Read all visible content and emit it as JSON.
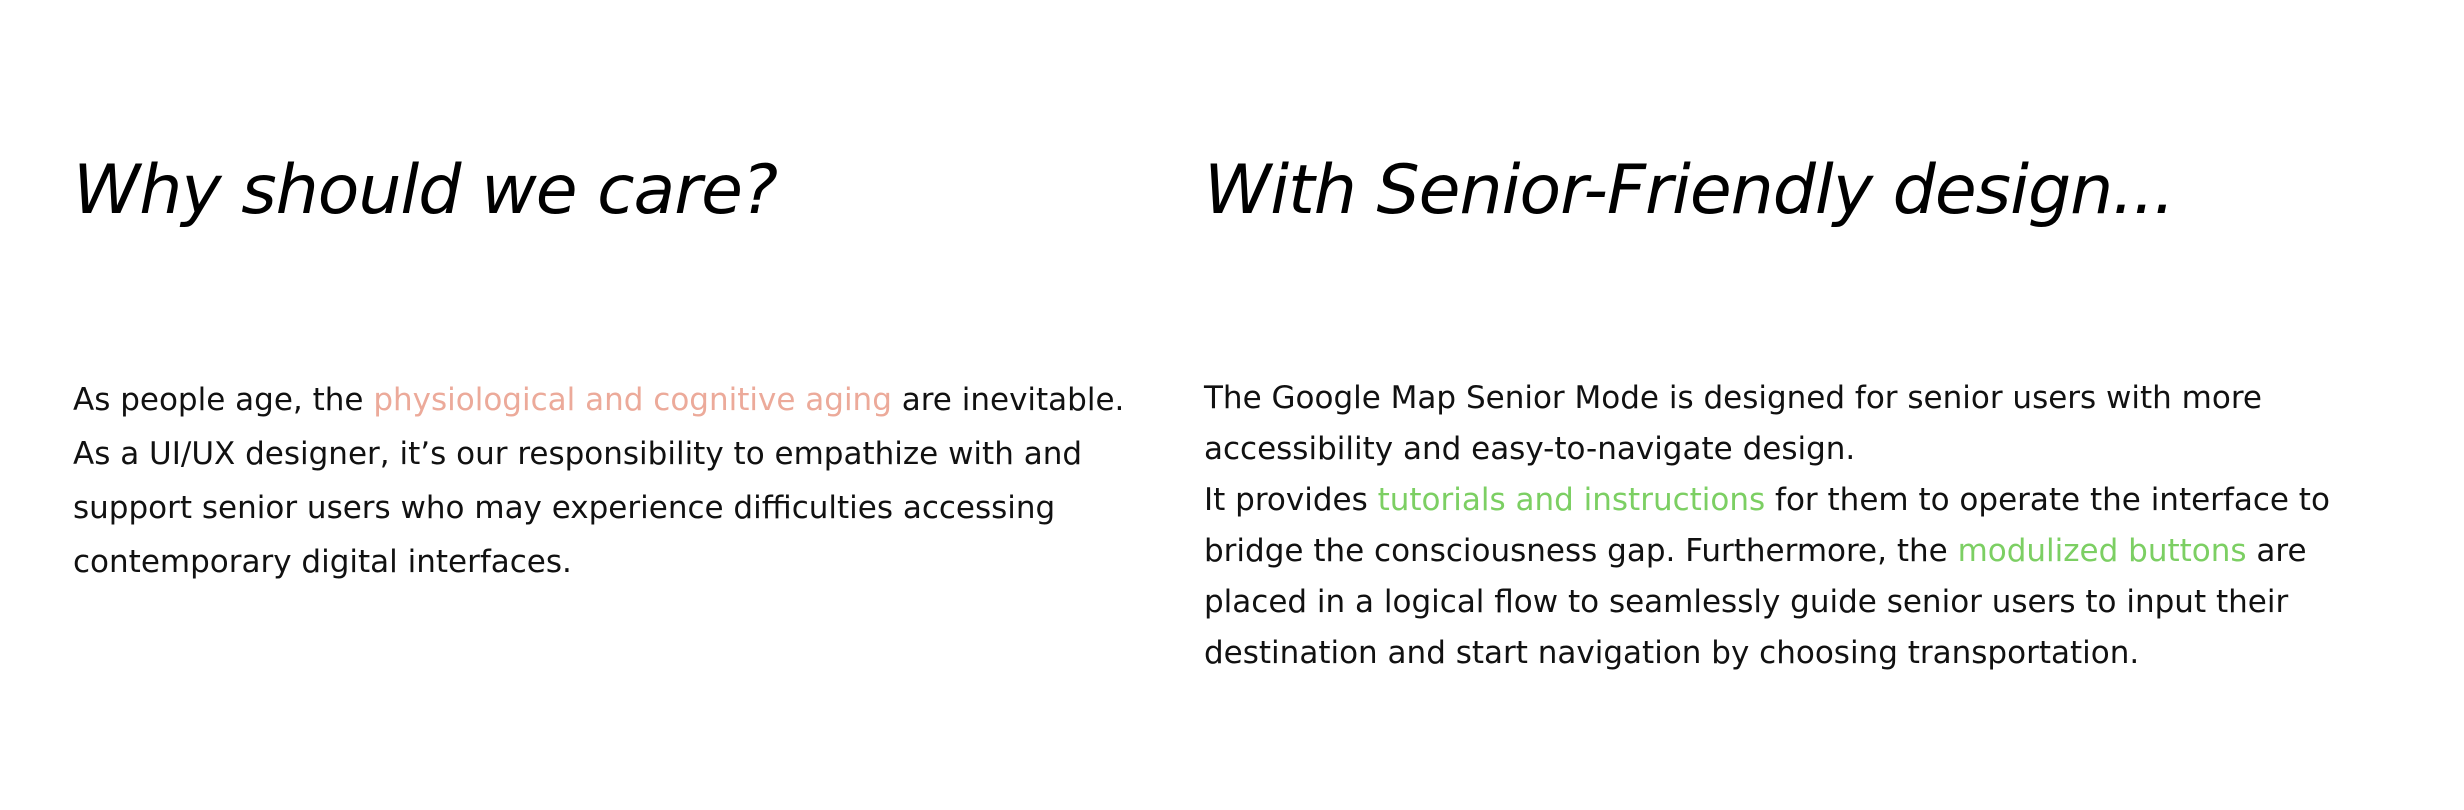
{
  "left": {
    "heading": "Why should we care?",
    "paragraph": {
      "line1_before": "As people age, the ",
      "line1_highlight": "physiological and cognitive aging",
      "line1_after": " are inevitable.",
      "line2": "As a UI/UX designer, it’s our responsibility to empathize with and",
      "line3": "support senior users who may experience difficulties accessing",
      "line4": "contemporary digital interfaces."
    }
  },
  "right": {
    "heading": "With Senior-Friendly design...",
    "paragraph": {
      "line1": "The Google Map Senior Mode is designed for senior users with more",
      "line2": "accessibility and easy-to-navigate design.",
      "line3_before": "It provides ",
      "line3_highlight": "tutorials and instructions",
      "line3_after": " for them to operate the interface to",
      "line4_before": "bridge the consciousness gap. Furthermore, the ",
      "line4_highlight": "modulized buttons",
      "line4_after": " are",
      "line5": "placed in a logical flow to seamlessly guide senior users to input their",
      "line6": "destination and start navigation by choosing transportation."
    }
  },
  "colors": {
    "highlight_salmon": "#ecaa9a",
    "highlight_green": "#7ccf63",
    "text": "#111111",
    "background": "#ffffff"
  }
}
